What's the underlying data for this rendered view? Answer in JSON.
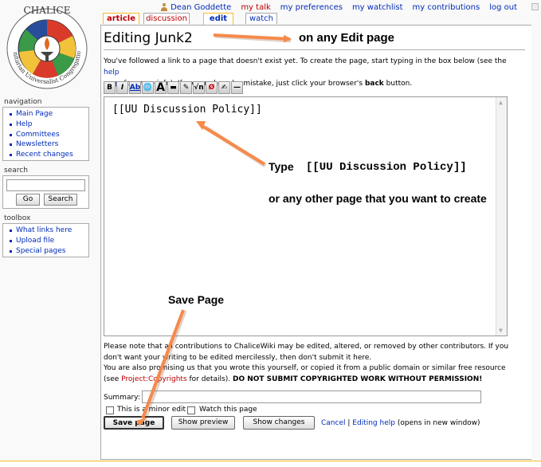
{
  "personal": {
    "username": "Dean Goddette",
    "talk": "my talk",
    "preferences": "my preferences",
    "watchlist": "my watchlist",
    "contributions": "my contributions",
    "logout": "log out"
  },
  "tabs": [
    {
      "label": "article"
    },
    {
      "label": "discussion"
    },
    {
      "label": "edit"
    },
    {
      "label": "watch"
    }
  ],
  "logo": {
    "top_text": "CHALICE",
    "ring_text": "Unitarian Universalist Congregation"
  },
  "sidebar": {
    "navigation": {
      "title": "navigation",
      "items": [
        "Main Page",
        "Help",
        "Committees",
        "Newsletters",
        "Recent changes"
      ]
    },
    "search": {
      "title": "search",
      "go": "Go",
      "search": "Search"
    },
    "toolbox": {
      "title": "toolbox",
      "items": [
        "What links here",
        "Upload file",
        "Special pages"
      ]
    }
  },
  "page": {
    "title": "Editing Junk2",
    "intro_1": "You've followed a link to a page that doesn't exist yet. To create the page, start typing in the box below (see the ",
    "intro_help_link": "help",
    "intro_2": "page",
    "intro_3": " for more info). If you are here by mistake, just click your browser's ",
    "intro_back": "back",
    "intro_4": " button.",
    "editbox_text": "[[UU Discussion Policy]]",
    "note_1": "Please note that all contributions to ChaliceWiki may be edited, altered, or removed by other contributors. If you don't want your writing to be edited mercilessly, then don't submit it here.",
    "note_2a": "You are also promising us that you wrote this yourself, or copied it from a public domain or similar free resource (see ",
    "note_2_link": "Project:Copyrights",
    "note_2b": " for details). ",
    "note_2_bold": "DO NOT SUBMIT COPYRIGHTED WORK WITHOUT PERMISSION!",
    "summary_label": "Summary:",
    "minor_edit": "This is a minor edit",
    "watch_page": "Watch this page",
    "save": "Save page",
    "preview": "Show preview",
    "changes": "Show changes",
    "cancel": "Cancel",
    "separator": "|",
    "editing_help": "Editing help",
    "new_window": "(opens in new window)"
  },
  "toolbar": {
    "buttons": [
      "B",
      "I",
      "Ab",
      "🌐",
      "A",
      "▬",
      "✎",
      "√n",
      "Ø",
      "✍",
      "—"
    ]
  },
  "annotations": {
    "edit_page": "on any Edit page",
    "type_word": "Type",
    "type_code": "[[UU Discussion Policy]]",
    "other_page": "or any other page that you want to create",
    "save_page": "Save Page"
  },
  "colors": {
    "arrow": "#f58a4b",
    "link": "#002bb8",
    "new_link": "#ba0000",
    "tab_selected": "#fabd23"
  }
}
